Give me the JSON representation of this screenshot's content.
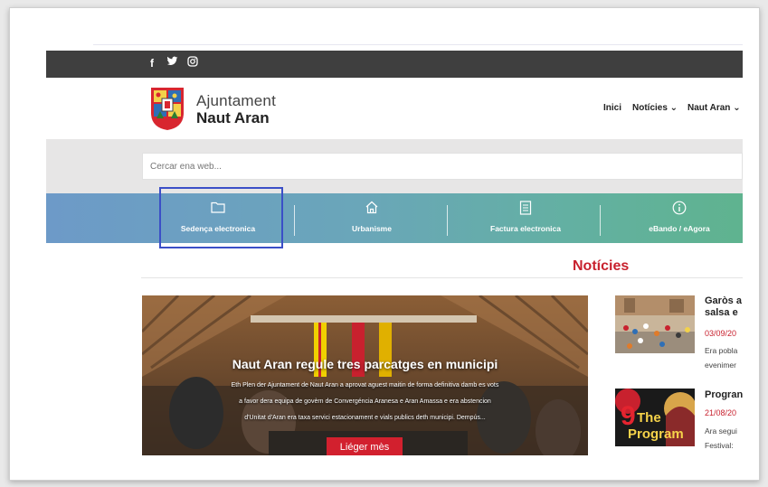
{
  "social": {
    "icons": [
      "facebook-icon",
      "twitter-icon",
      "instagram-icon"
    ],
    "facebook": "f",
    "twitter": "🐦",
    "instagram": "◎"
  },
  "header": {
    "brand_line1": "Ajuntament",
    "brand_line2": "Naut Aran",
    "nav": [
      {
        "label": "Inici"
      },
      {
        "label": "Notícies ⌄"
      },
      {
        "label": "Naut Aran ⌄"
      }
    ]
  },
  "search": {
    "placeholder": "Cercar ena web..."
  },
  "quick_links": [
    {
      "label": "Sedença electronica",
      "icon": "folder-icon"
    },
    {
      "label": "Urbanisme",
      "icon": "home-icon"
    },
    {
      "label": "Factura electronica",
      "icon": "document-icon"
    },
    {
      "label": "eBando / eAgora",
      "icon": "info-icon"
    }
  ],
  "news": {
    "section_title": "Notícies",
    "feature": {
      "title": "Naut Aran regule tres parcatges en municipi",
      "lines": [
        "Eth Plen der Ajuntament de Naut Aran a aprovat aguest maitin de forma definitiva damb es vots",
        "a favor dera equipa de govèrn de Convergéncia Aranesa e Aran Amassa e era abstencion",
        "d'Unitat d'Aran era taxa servici estacionament e vials publics deth municipi. Dempús..."
      ],
      "read_more": "Liéger mès"
    },
    "side": [
      {
        "title_l1": "Garòs a",
        "title_l2": "salsa e",
        "date": "03/09/20",
        "excerpt_l1": "Era pobla",
        "excerpt_l2": "evenimer"
      },
      {
        "title_l1": "Progran",
        "title_l2": "",
        "date": "21/08/20",
        "excerpt_l1": "Ara segui",
        "excerpt_l2": "Festival:"
      }
    ],
    "poster_text_1": "9",
    "poster_text_2": "The",
    "poster_text_3": "Program"
  },
  "colors": {
    "accent": "#c8212e",
    "topbar": "#3f3f3f",
    "highlight": "#3b4fc7"
  }
}
